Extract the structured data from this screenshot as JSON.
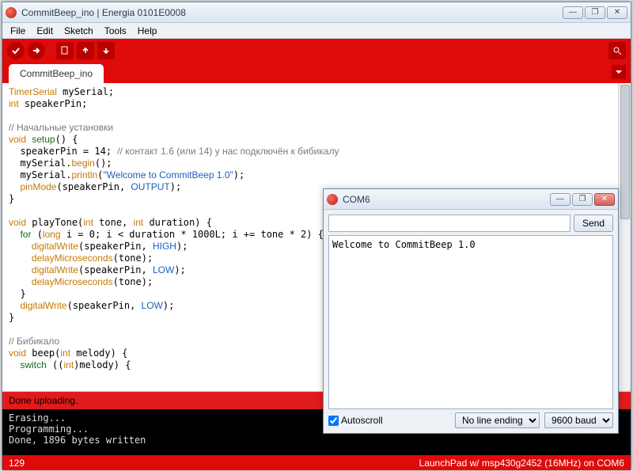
{
  "window": {
    "title": "CommitBeep_ino | Energia 0101E0008",
    "minimize": "—",
    "maximize": "❐",
    "close": "✕"
  },
  "menu": {
    "items": [
      "File",
      "Edit",
      "Sketch",
      "Tools",
      "Help"
    ]
  },
  "tabs": {
    "active": "CommitBeep_ino"
  },
  "code_tokens": [
    [
      [
        "c-type",
        "TimerSerial"
      ],
      [
        "",
        " mySerial;"
      ]
    ],
    [
      [
        "c-type",
        "int"
      ],
      [
        "",
        " speakerPin;"
      ]
    ],
    [
      [
        "",
        ""
      ]
    ],
    [
      [
        "c-cmt",
        "// Начальные установки"
      ]
    ],
    [
      [
        "c-type",
        "void"
      ],
      [
        "",
        " "
      ],
      [
        "c-kw",
        "setup"
      ],
      [
        "",
        "() {"
      ]
    ],
    [
      [
        "",
        "  speakerPin = 14; "
      ],
      [
        "c-cmt",
        "// контакт 1.6 (или 14) у нас подключён к бибикалу"
      ]
    ],
    [
      [
        "",
        "  mySerial."
      ],
      [
        "c-fn",
        "begin"
      ],
      [
        "",
        "();"
      ]
    ],
    [
      [
        "",
        "  mySerial."
      ],
      [
        "c-fn",
        "println"
      ],
      [
        "",
        "("
      ],
      [
        "c-str",
        "\"Welcome to CommitBeep 1.0\""
      ],
      [
        "",
        ");"
      ]
    ],
    [
      [
        "",
        "  "
      ],
      [
        "c-fn",
        "pinMode"
      ],
      [
        "",
        "(speakerPin, "
      ],
      [
        "c-const",
        "OUTPUT"
      ],
      [
        "",
        ");"
      ]
    ],
    [
      [
        "",
        "}"
      ]
    ],
    [
      [
        "",
        ""
      ]
    ],
    [
      [
        "c-type",
        "void"
      ],
      [
        "",
        " playTone("
      ],
      [
        "c-type",
        "int"
      ],
      [
        "",
        " tone, "
      ],
      [
        "c-type",
        "int"
      ],
      [
        "",
        " duration) {"
      ]
    ],
    [
      [
        "",
        "  "
      ],
      [
        "c-kw",
        "for"
      ],
      [
        "",
        " ("
      ],
      [
        "c-type",
        "long"
      ],
      [
        "",
        " i = 0; i < duration * 1000L; i += tone * 2) {"
      ]
    ],
    [
      [
        "",
        "    "
      ],
      [
        "c-fn",
        "digitalWrite"
      ],
      [
        "",
        "(speakerPin, "
      ],
      [
        "c-const",
        "HIGH"
      ],
      [
        "",
        ");"
      ]
    ],
    [
      [
        "",
        "    "
      ],
      [
        "c-fn",
        "delayMicroseconds"
      ],
      [
        "",
        "(tone);"
      ]
    ],
    [
      [
        "",
        "    "
      ],
      [
        "c-fn",
        "digitalWrite"
      ],
      [
        "",
        "(speakerPin, "
      ],
      [
        "c-const",
        "LOW"
      ],
      [
        "",
        ");"
      ]
    ],
    [
      [
        "",
        "    "
      ],
      [
        "c-fn",
        "delayMicroseconds"
      ],
      [
        "",
        "(tone);"
      ]
    ],
    [
      [
        "",
        "  }"
      ]
    ],
    [
      [
        "",
        "  "
      ],
      [
        "c-fn",
        "digitalWrite"
      ],
      [
        "",
        "(speakerPin, "
      ],
      [
        "c-const",
        "LOW"
      ],
      [
        "",
        ");"
      ]
    ],
    [
      [
        "",
        "}"
      ]
    ],
    [
      [
        "",
        ""
      ]
    ],
    [
      [
        "c-cmt",
        "// Бибикало"
      ]
    ],
    [
      [
        "c-type",
        "void"
      ],
      [
        "",
        " beep("
      ],
      [
        "c-type",
        "int"
      ],
      [
        "",
        " melody) {"
      ]
    ],
    [
      [
        "",
        "  "
      ],
      [
        "c-kw",
        "switch"
      ],
      [
        "",
        " (("
      ],
      [
        "c-type",
        "int"
      ],
      [
        "",
        ")melody) {"
      ]
    ]
  ],
  "status": {
    "line": "Done uploading."
  },
  "console_lines": [
    "Erasing...",
    "Programming...",
    "Done, 1896 bytes written"
  ],
  "footer": {
    "left": "129",
    "right": "LaunchPad w/ msp430g2452 (16MHz) on COM6"
  },
  "serial": {
    "title": "COM6",
    "send_label": "Send",
    "input_value": "",
    "output": "Welcome to CommitBeep 1.0",
    "autoscroll_label": "Autoscroll",
    "autoscroll_checked": true,
    "line_ending": "No line ending",
    "baud": "9600 baud"
  }
}
